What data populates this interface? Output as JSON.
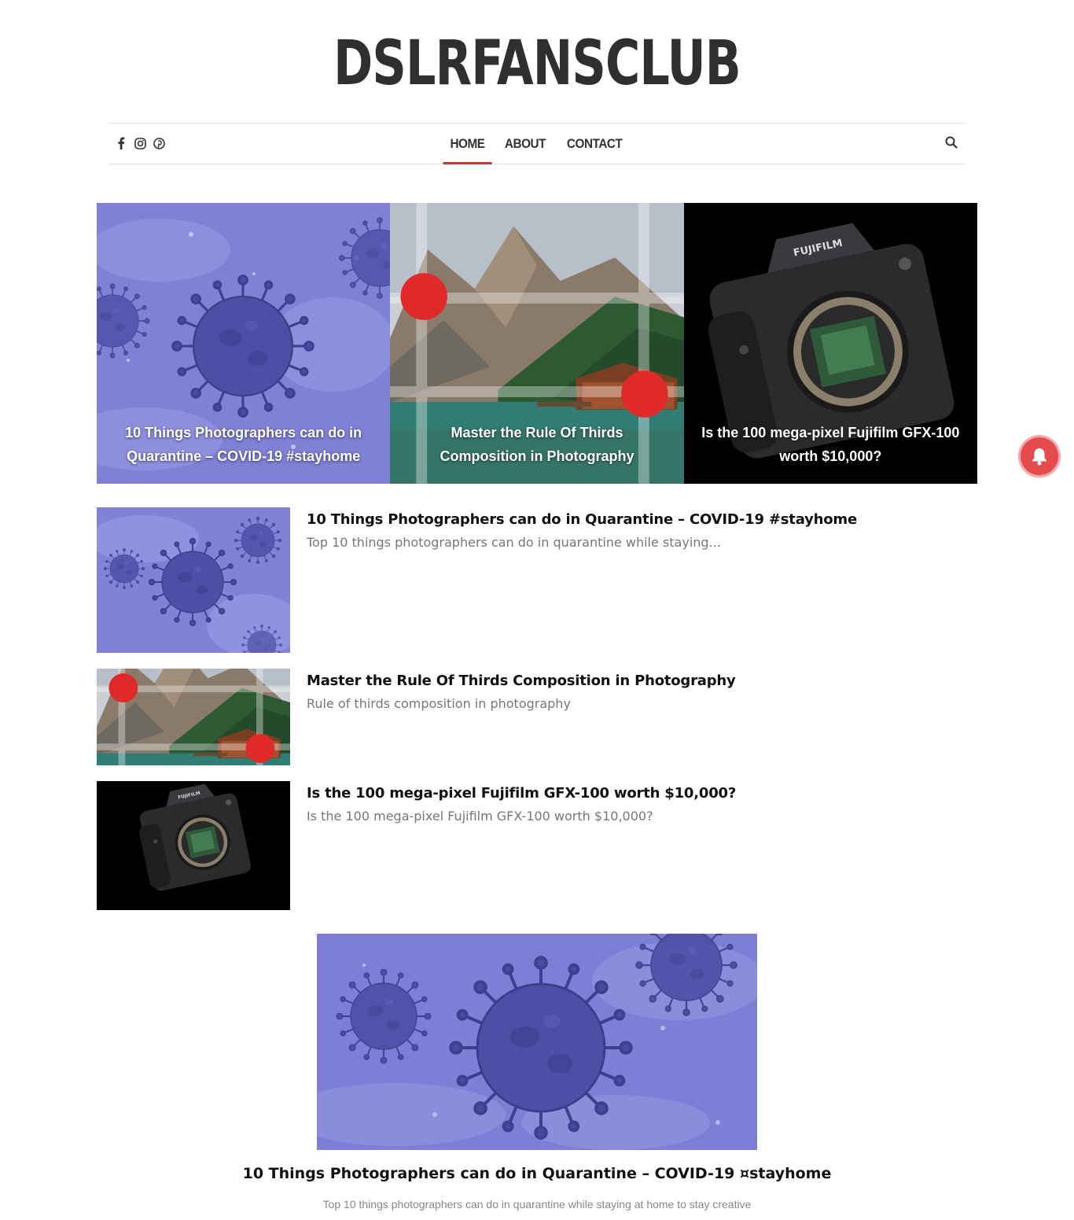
{
  "site": {
    "title": "DSLRFANSCLUB"
  },
  "social": [
    {
      "icon": "facebook-icon"
    },
    {
      "icon": "instagram-icon"
    },
    {
      "icon": "pinterest-icon"
    }
  ],
  "nav": {
    "items": [
      {
        "label": "HOME",
        "active": true
      },
      {
        "label": "ABOUT",
        "active": false
      },
      {
        "label": "CONTACT",
        "active": false
      }
    ],
    "search_icon": "search-icon"
  },
  "slider": [
    {
      "title": "10 Things Photographers can do in Quarantine – COVID-19 #stayhome"
    },
    {
      "title": "Master the Rule Of Thirds Composition in Photography"
    },
    {
      "title": "Is the 100 mega-pixel Fujifilm GFX-100 worth $10,000?"
    }
  ],
  "posts": [
    {
      "title": "10 Things Photographers can do in Quarantine – COVID-19 #stayhome",
      "excerpt": "Top 10 things photographers can do in quarantine while staying..."
    },
    {
      "title": "Master the Rule Of Thirds Composition in Photography",
      "excerpt": "Rule of thirds composition in photography"
    },
    {
      "title": "Is the 100 mega-pixel Fujifilm GFX-100 worth $10,000?",
      "excerpt": "Is the 100 mega-pixel Fujifilm GFX-100 worth $10,000?"
    }
  ],
  "featured": {
    "title": "10 Things Photographers can do in Quarantine – COVID-19 ¤stayhome",
    "excerpt": "Top 10 things photographers can do in quarantine while staying at home to stay creative"
  },
  "colors": {
    "accent": "#c0392b",
    "virus_bg": "#7f80d6",
    "virus_body": "#4a4aa0",
    "notification": "#e54b4d"
  }
}
